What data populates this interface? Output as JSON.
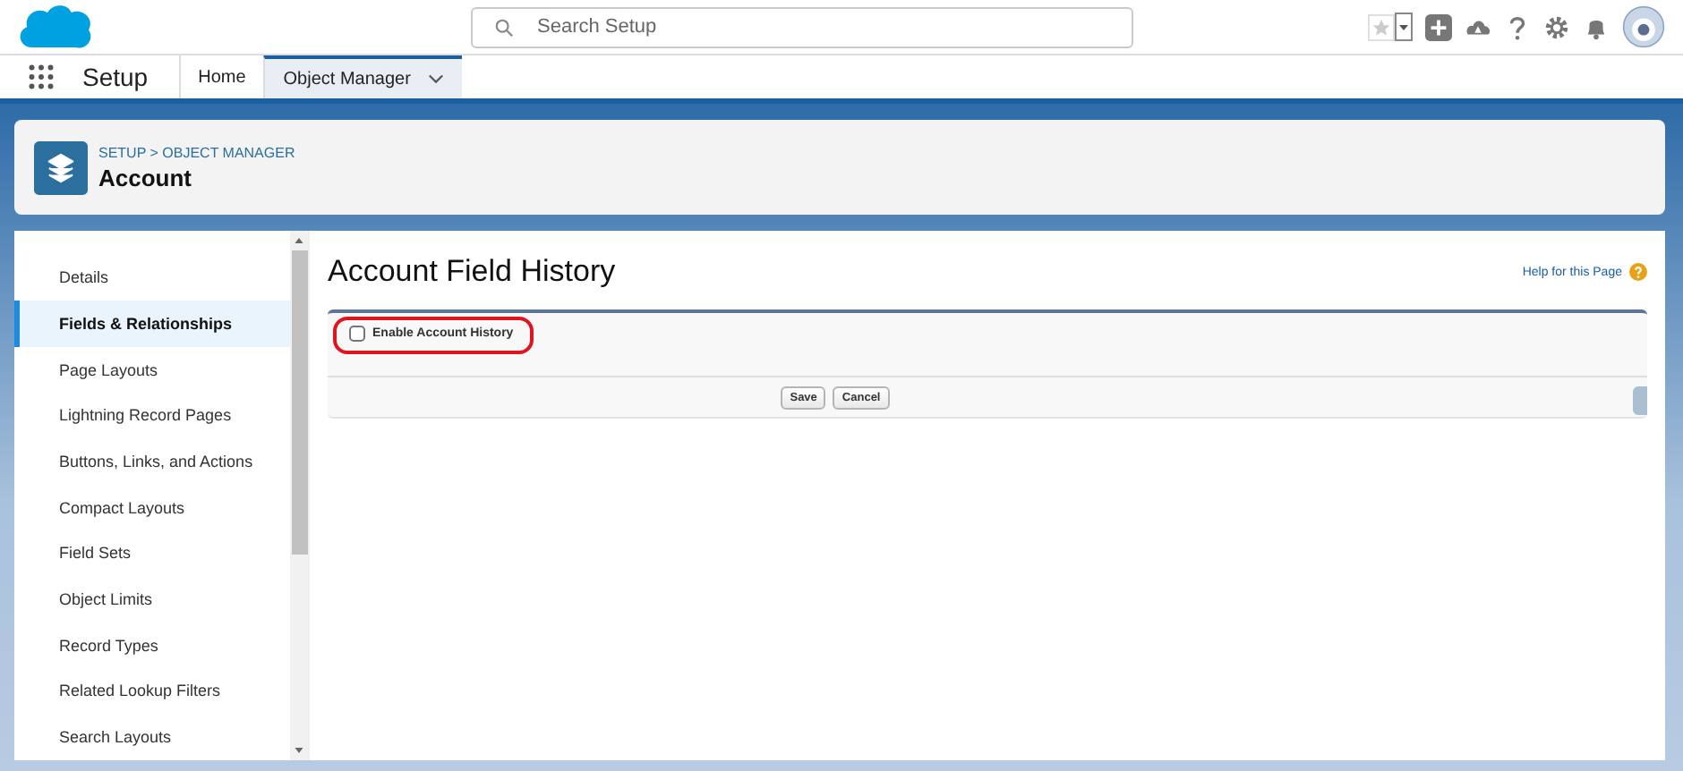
{
  "search": {
    "placeholder": "Search Setup"
  },
  "nav": {
    "app_name": "Setup",
    "tabs": [
      {
        "label": "Home",
        "selected": false,
        "dropdown": false
      },
      {
        "label": "Object Manager",
        "selected": true,
        "dropdown": true
      }
    ]
  },
  "header": {
    "breadcrumb": "SETUP > OBJECT MANAGER",
    "title": "Account"
  },
  "sidebar": {
    "items": [
      {
        "label": "Details",
        "selected": false
      },
      {
        "label": "Fields & Relationships",
        "selected": true
      },
      {
        "label": "Page Layouts",
        "selected": false
      },
      {
        "label": "Lightning Record Pages",
        "selected": false
      },
      {
        "label": "Buttons, Links, and Actions",
        "selected": false
      },
      {
        "label": "Compact Layouts",
        "selected": false
      },
      {
        "label": "Field Sets",
        "selected": false
      },
      {
        "label": "Object Limits",
        "selected": false
      },
      {
        "label": "Record Types",
        "selected": false
      },
      {
        "label": "Related Lookup Filters",
        "selected": false
      },
      {
        "label": "Search Layouts",
        "selected": false
      }
    ]
  },
  "content": {
    "title": "Account Field History",
    "help_link": "Help for this Page",
    "option": {
      "label": "Enable Account History",
      "checked": false,
      "highlighted": true
    },
    "buttons": [
      "Save",
      "Cancel"
    ]
  }
}
